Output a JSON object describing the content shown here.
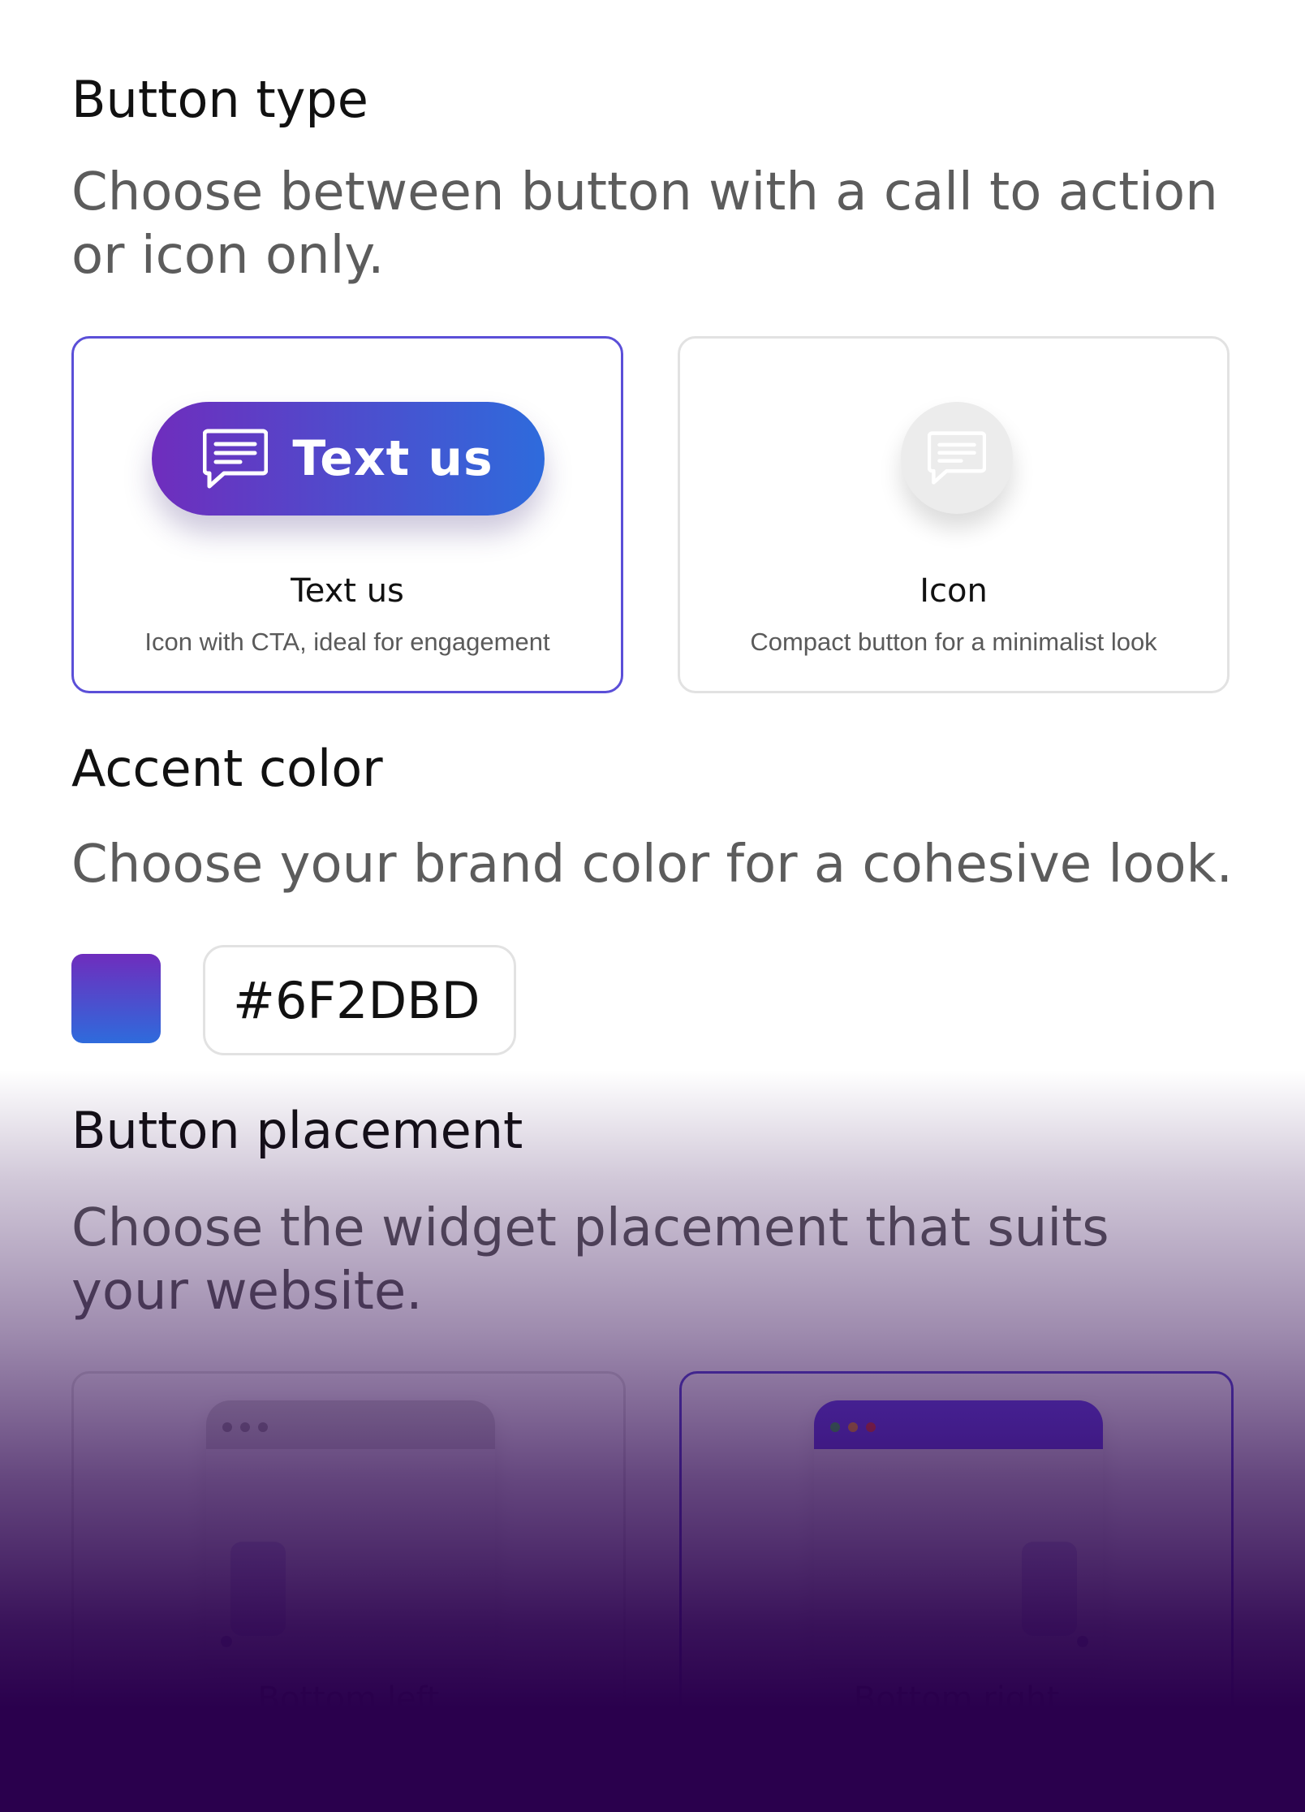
{
  "button_type": {
    "title": "Button type",
    "description": "Choose between button with a call to action or icon only.",
    "options": [
      {
        "preview_label": "Text us",
        "label": "Text us",
        "sublabel": "Icon with CTA, ideal for engagement",
        "selected": true,
        "icon": "chat-bubble-icon"
      },
      {
        "label": "Icon",
        "sublabel": "Compact button for a minimalist look",
        "selected": false,
        "icon": "chat-bubble-icon"
      }
    ]
  },
  "accent_color": {
    "title": "Accent color",
    "description": "Choose your brand color for a cohesive look.",
    "value": "#6F2DBD",
    "display_value": "#6F2DBD"
  },
  "button_placement": {
    "title": "Button placement",
    "description": "Choose the widget placement that suits your website.",
    "options": [
      {
        "label": "Bottom left",
        "selected": false
      },
      {
        "label": "Bottom right",
        "selected": true
      }
    ]
  },
  "colors": {
    "accent": "#6F2DBD",
    "accent_end": "#2e6bdc",
    "selected_border": "#5b4fd8",
    "overlay": "#2a004d"
  }
}
